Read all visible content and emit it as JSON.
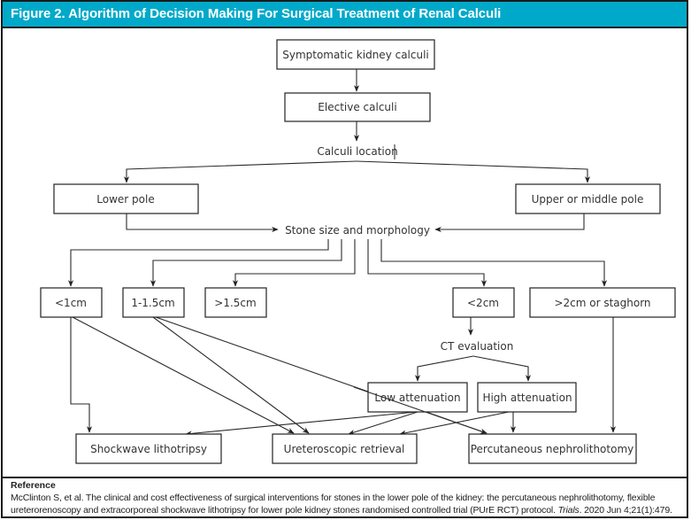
{
  "figure": {
    "title": "Figure 2. Algorithm of Decision Making For Surgical Treatment of Renal Calculi",
    "header_color": "#00a9c9"
  },
  "nodes": {
    "symptomatic": "Symptomatic kidney calculi",
    "elective": "Elective calculi",
    "calculi_location": "Calculi location",
    "lower_pole": "Lower pole",
    "upper_middle_pole": "Upper or middle pole",
    "stone_size": "Stone size and morphology",
    "lt1cm": "<1cm",
    "1to1_5cm": "1-1.5cm",
    "gt1_5cm": ">1.5cm",
    "lt2cm": "<2cm",
    "gt2cm_staghorn": ">2cm or staghorn",
    "ct_evaluation": "CT evaluation",
    "low_attenuation": "Low attenuation",
    "high_attenuation": "High attenuation",
    "swl": "Shockwave lithotripsy",
    "urs": "Ureteroscopic retrieval",
    "pcnl": "Percutaneous nephrolithotomy"
  },
  "edges": [
    [
      "symptomatic",
      "elective"
    ],
    [
      "elective",
      "calculi_location"
    ],
    [
      "calculi_location",
      "lower_pole"
    ],
    [
      "calculi_location",
      "upper_middle_pole"
    ],
    [
      "lower_pole",
      "stone_size"
    ],
    [
      "upper_middle_pole",
      "stone_size"
    ],
    [
      "stone_size",
      "lt1cm"
    ],
    [
      "stone_size",
      "1to1_5cm"
    ],
    [
      "stone_size",
      "gt1_5cm"
    ],
    [
      "stone_size",
      "lt2cm"
    ],
    [
      "stone_size",
      "gt2cm_staghorn"
    ],
    [
      "lt1cm",
      "swl"
    ],
    [
      "lt1cm",
      "urs"
    ],
    [
      "1to1_5cm",
      "urs"
    ],
    [
      "1to1_5cm",
      "pcnl"
    ],
    [
      "lt2cm",
      "ct_evaluation"
    ],
    [
      "ct_evaluation",
      "low_attenuation"
    ],
    [
      "ct_evaluation",
      "high_attenuation"
    ],
    [
      "low_attenuation",
      "swl"
    ],
    [
      "low_attenuation",
      "urs"
    ],
    [
      "high_attenuation",
      "urs"
    ],
    [
      "high_attenuation",
      "pcnl"
    ],
    [
      "gt2cm_staghorn",
      "pcnl"
    ]
  ],
  "reference": {
    "heading": "Reference",
    "text_before_journal": "McClinton S, et al. The clinical and cost effectiveness of surgical interventions for stones in the lower pole of the kidney: the percutaneous nephrolithotomy, flexible ureterorenoscopy and extracorporeal shockwave lithotripsy for lower pole kidney stones randomised controlled trial (PUrE RCT) protocol. ",
    "journal": "Trials",
    "text_after_journal": ". 2020 Jun 4;21(1):479."
  }
}
